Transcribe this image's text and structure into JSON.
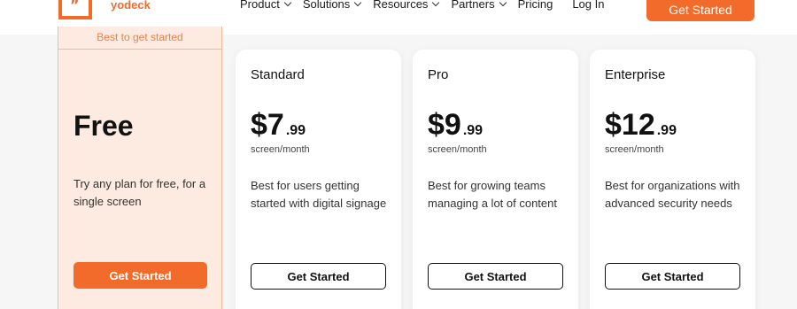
{
  "header": {
    "brand": "yodeck",
    "logo_glyph": "”",
    "nav": [
      {
        "label": "Product",
        "dropdown": true
      },
      {
        "label": "Solutions",
        "dropdown": true
      },
      {
        "label": "Resources",
        "dropdown": true
      },
      {
        "label": "Partners",
        "dropdown": true
      },
      {
        "label": "Pricing",
        "dropdown": false
      },
      {
        "label": "Log In",
        "dropdown": false
      }
    ],
    "cta": "Get Started"
  },
  "free_plan": {
    "badge": "Best to get started",
    "title": "Free",
    "description": "Try any plan for free, for a single screen",
    "button": "Get Started"
  },
  "plans": [
    {
      "name": "Standard",
      "amount": "$7",
      "cents": ".99",
      "period": "screen/month",
      "description": "Best for users getting started with digital signage",
      "button": "Get Started"
    },
    {
      "name": "Pro",
      "amount": "$9",
      "cents": ".99",
      "period": "screen/month",
      "description": "Best for growing teams managing a lot of content",
      "button": "Get Started"
    },
    {
      "name": "Enterprise",
      "amount": "$12",
      "cents": ".99",
      "period": "screen/month",
      "description": "Best for organizations with advanced security needs",
      "button": "Get Started"
    }
  ],
  "colors": {
    "accent": "#f26b2a",
    "free_bg": "#fdebe1",
    "page_bg": "#f6f6f6"
  }
}
